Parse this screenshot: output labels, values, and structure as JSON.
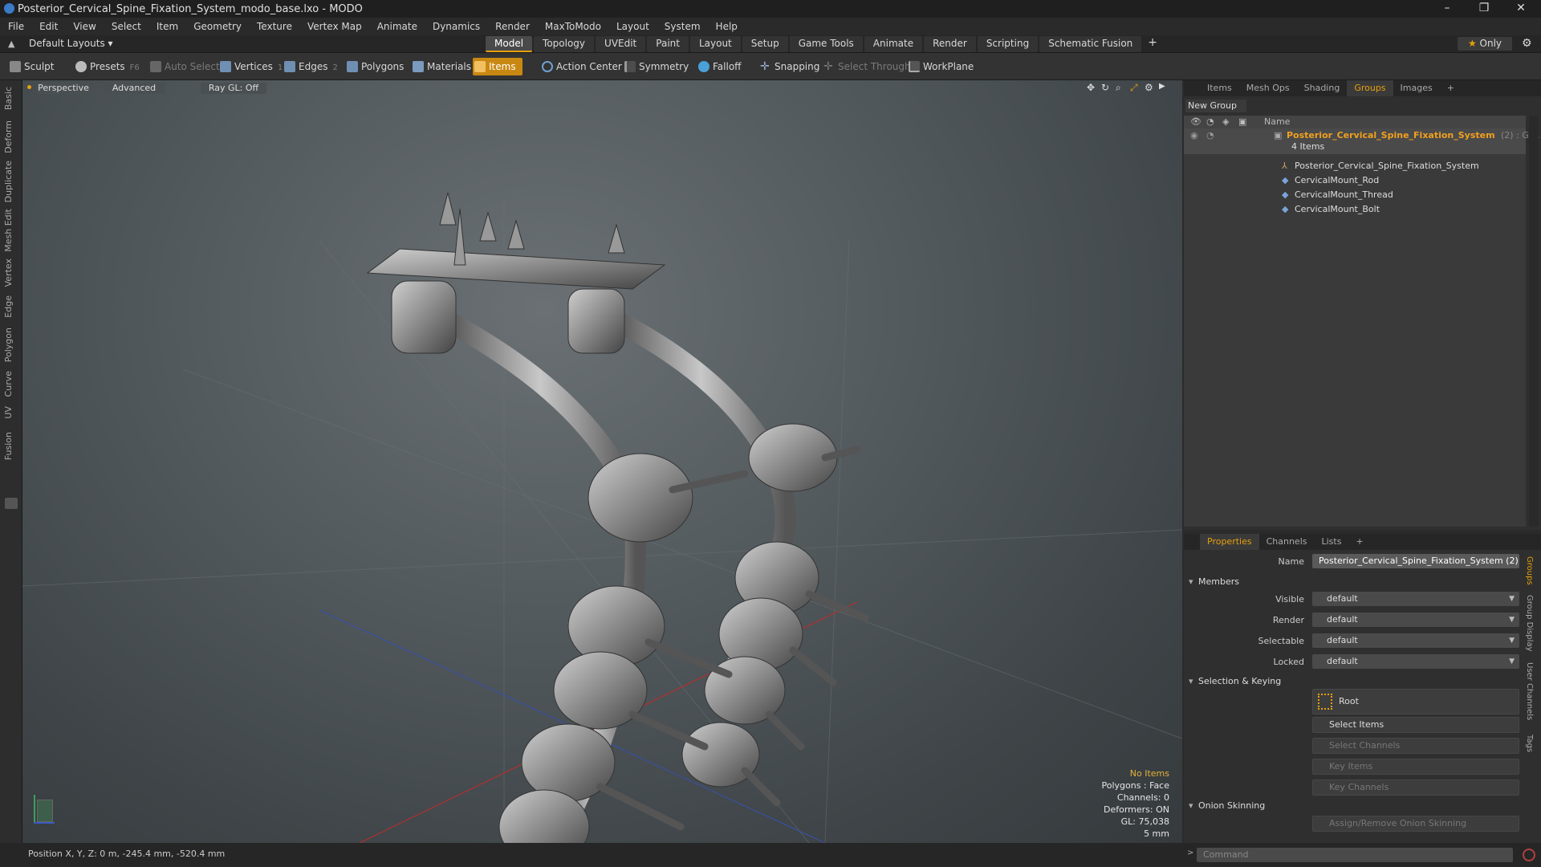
{
  "window": {
    "title": "Posterior_Cervical_Spine_Fixation_System_modo_base.lxo - MODO"
  },
  "menu": [
    "File",
    "Edit",
    "View",
    "Select",
    "Item",
    "Geometry",
    "Texture",
    "Vertex Map",
    "Animate",
    "Dynamics",
    "Render",
    "MaxToModo",
    "Layout",
    "System",
    "Help"
  ],
  "layout": {
    "selector": "Default Layouts",
    "tabs": [
      "Model",
      "Topology",
      "UVEdit",
      "Paint",
      "Layout",
      "Setup",
      "Game Tools",
      "Animate",
      "Render",
      "Scripting",
      "Schematic Fusion"
    ],
    "active_tab": "Model",
    "only_label": "Only"
  },
  "toolbar": {
    "sculpt": "Sculpt",
    "presets": "Presets",
    "presets_key": "F6",
    "auto_select": "Auto Select",
    "vertices": "Vertices",
    "vertices_count": "1",
    "edges": "Edges",
    "edges_count": "2",
    "polygons": "Polygons",
    "materials": "Materials",
    "items": "Items",
    "action_center": "Action Center",
    "symmetry": "Symmetry",
    "falloff": "Falloff",
    "snapping": "Snapping",
    "select_through": "Select Through",
    "workplane": "WorkPlane"
  },
  "left_tabs": [
    "Basic",
    "Deform",
    "Duplicate",
    "Mesh Edit",
    "Vertex",
    "Edge",
    "Polygon",
    "Curve",
    "UV",
    "Fusion"
  ],
  "viewport": {
    "perspective": "Perspective",
    "advanced": "Advanced",
    "raygl": "Ray GL: Off",
    "info": {
      "no_items": "No Items",
      "polygons": "Polygons : Face",
      "channels": "Channels: 0",
      "deformers": "Deformers: ON",
      "gl": "GL: 75,038",
      "scale": "5 mm"
    }
  },
  "right_panel": {
    "tabs": [
      "Items",
      "Mesh Ops",
      "Shading",
      "Groups",
      "Images"
    ],
    "active_tab": "Groups",
    "new_group": "New Group",
    "name_header": "Name",
    "group": {
      "name": "Posterior_Cervical_Spine_Fixation_System",
      "count_suffix": "(2) : Gr...",
      "items_label": "4 Items",
      "children": [
        "Posterior_Cervical_Spine_Fixation_System",
        "CervicalMount_Rod",
        "CervicalMount_Thread",
        "CervicalMount_Bolt"
      ]
    }
  },
  "properties": {
    "tabs": [
      "Properties",
      "Channels",
      "Lists"
    ],
    "active_tab": "Properties",
    "name_label": "Name",
    "name_value": "Posterior_Cervical_Spine_Fixation_System (2)",
    "members_section": "Members",
    "fields": [
      {
        "label": "Visible",
        "value": "default"
      },
      {
        "label": "Render",
        "value": "default"
      },
      {
        "label": "Selectable",
        "value": "default"
      },
      {
        "label": "Locked",
        "value": "default"
      }
    ],
    "selection_section": "Selection & Keying",
    "root_label": "Root",
    "select_items": "Select Items",
    "select_channels": "Select Channels",
    "key_items": "Key Items",
    "key_channels": "Key Channels",
    "onion_section": "Onion Skinning",
    "onion_button": "Assign/Remove Onion Skinning",
    "side_tabs": [
      "Groups",
      "Group Display",
      "User Channels",
      "Tags"
    ]
  },
  "status": {
    "position": "Position X, Y, Z:  0 m, -245.4 mm, -520.4 mm"
  },
  "command": {
    "placeholder": "Command"
  },
  "colors": {
    "accent": "#e5a00d",
    "group_name": "#f0a020"
  }
}
